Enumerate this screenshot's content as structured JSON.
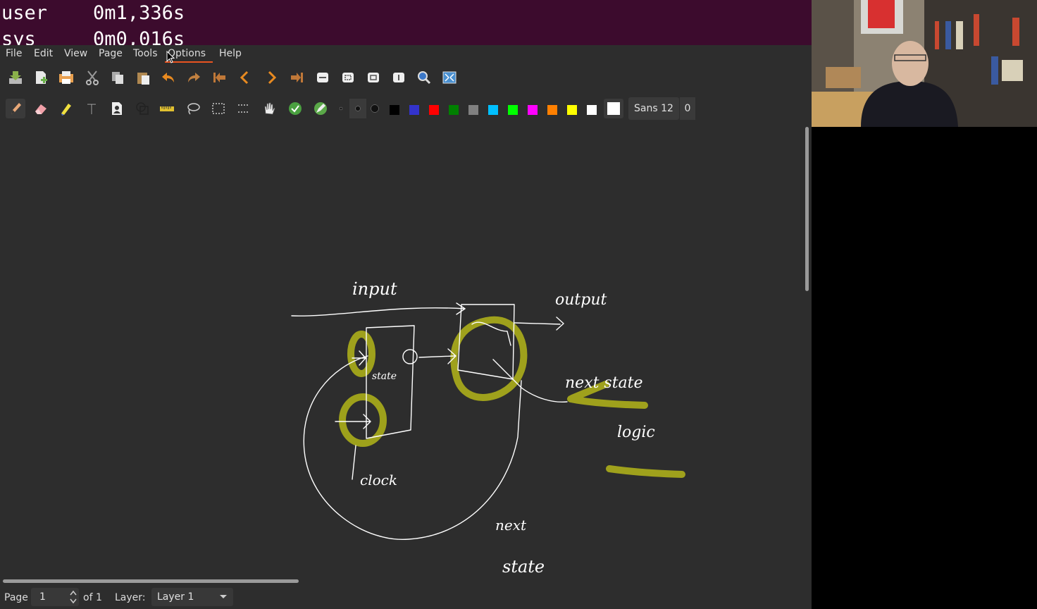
{
  "terminal": {
    "lines": [
      "user    0m1,336s",
      "sys     0m0,016s"
    ]
  },
  "menu": {
    "items": [
      "File",
      "Edit",
      "View",
      "Page",
      "Tools",
      "Options",
      "Help"
    ]
  },
  "colors": {
    "accent": "#e95420",
    "palette": [
      "#000000",
      "#3333cc",
      "#ff0000",
      "#008000",
      "#808080",
      "#00c0ff",
      "#00ff00",
      "#ff00ff",
      "#ff8000",
      "#ffff00",
      "#ffffff"
    ],
    "highlighter": "#a5a81b",
    "pen": "#ffffff"
  },
  "toolbar1": {
    "icons": [
      "save-icon",
      "new-page-icon",
      "print-icon",
      "cut-icon",
      "copy-icon",
      "paste-icon",
      "undo-icon",
      "redo-icon",
      "first-page-icon",
      "previous-page-icon",
      "next-page-icon",
      "last-page-icon",
      "zoom-fit-width-icon",
      "zoom-fit-page-icon",
      "zoom-100-icon",
      "page-width-icon",
      "zoom-icon",
      "fullscreen-icon"
    ]
  },
  "toolbar2": {
    "icons": [
      "pen-icon",
      "eraser-icon",
      "highlighter-icon",
      "text-icon",
      "image-icon",
      "shape-icon",
      "ruler-icon",
      "lasso-icon",
      "rect-select-icon",
      "vertical-space-icon",
      "hand-icon",
      "shape-recognizer-icon",
      "default-tool-icon"
    ],
    "font_label": "Sans 12",
    "font_size_extra": "0"
  },
  "canvas": {
    "handwriting": [
      "input",
      "output",
      "state",
      "next state",
      "logic",
      "clock",
      "next",
      "state"
    ]
  },
  "status": {
    "page_label": "Page",
    "page_value": "1",
    "of_label": "of 1",
    "layer_label": "Layer:",
    "layer_value": "Layer 1"
  }
}
